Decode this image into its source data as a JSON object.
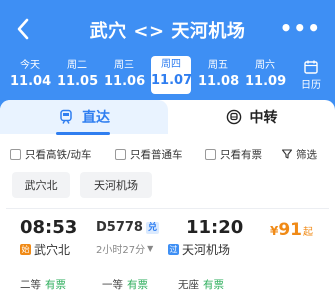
{
  "header": {
    "title": "武穴 <> 天河机场",
    "more": "•••",
    "bg_color": "#3e8ff4",
    "back_icon": "chevron-left-icon"
  },
  "dates": [
    {
      "weekday": "今天",
      "date": "11.04",
      "active": false
    },
    {
      "weekday": "周二",
      "date": "11.05",
      "active": false
    },
    {
      "weekday": "周三",
      "date": "11.06",
      "active": false
    },
    {
      "weekday": "周四",
      "date": "11.07",
      "active": true
    },
    {
      "weekday": "周五",
      "date": "11.08",
      "active": false
    },
    {
      "weekday": "周六",
      "date": "11.09",
      "active": false
    }
  ],
  "calendar": {
    "label": "日历",
    "icon": "calendar-icon"
  },
  "tabs": {
    "direct": {
      "label": "直达",
      "icon": "train-icon"
    },
    "transfer": {
      "label": "中转",
      "icon": "transfer-icon"
    }
  },
  "filters": {
    "highspeed": "只看高铁/动车",
    "normal": "只看普通车",
    "available": "只看有票",
    "filter": "筛选"
  },
  "chips": {
    "from": "武穴北",
    "to": "天河机场"
  },
  "train": {
    "depart_time": "08:53",
    "arrive_time": "11:20",
    "number": "D5778",
    "badge": "兑",
    "duration": "2小时27分",
    "price_currency": "¥",
    "price_value": "91",
    "price_suffix": "起",
    "from_station": "武穴北",
    "from_badge": "始",
    "to_station": "天河机场",
    "to_badge": "过",
    "seats": [
      {
        "class": "二等",
        "status": "有票"
      },
      {
        "class": "一等",
        "status": "有票"
      },
      {
        "class": "无座",
        "status": "有票"
      }
    ]
  },
  "colors": {
    "accent": "#2f7ef0",
    "price": "#f08a16",
    "available": "#2eae5c",
    "from_badge": "#f08a16",
    "to_badge": "#3e8ff4"
  }
}
